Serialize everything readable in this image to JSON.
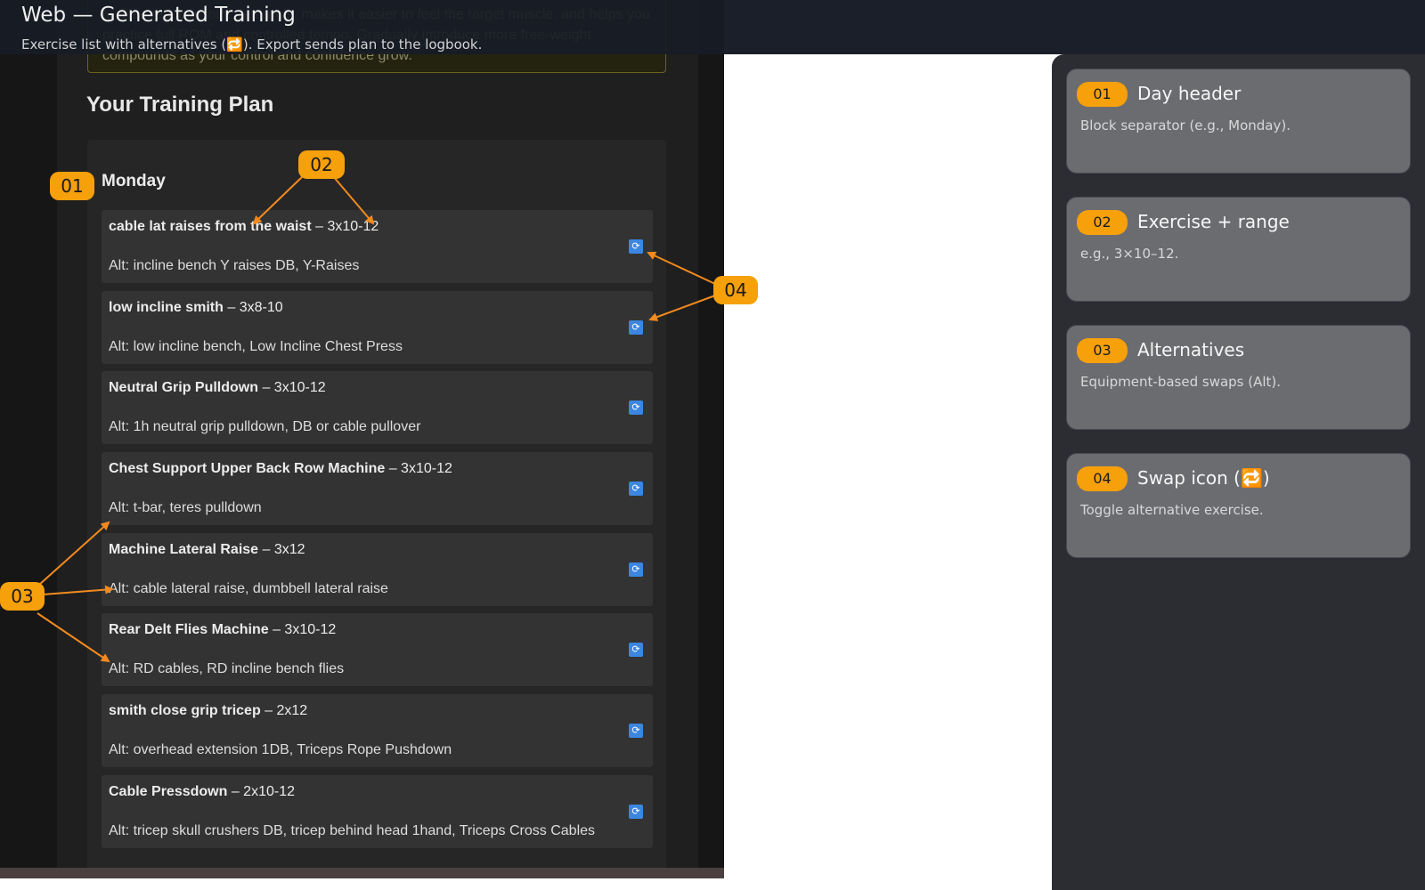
{
  "header": {
    "title": "Web — Generated Training",
    "subtitle": "Exercise list with alternatives (🔁). Export sends plan to the logbook."
  },
  "note_text": "ly. This reduces joint demands, makes it easier to feel the target muscle, and helps you practice full ROM and controlled tempo. Gradually introduce more free-weight compounds as your control and confidence grow.",
  "plan_title": "Your Training Plan",
  "day": "Monday",
  "exercises": [
    {
      "name": "cable lat raises from the waist",
      "range": " – 3x10-12",
      "alt": "Alt: incline bench Y raises DB, Y-Raises"
    },
    {
      "name": "low incline smith",
      "range": " – 3x8-10",
      "alt": "Alt: low incline bench, Low Incline Chest Press"
    },
    {
      "name": "Neutral Grip Pulldown",
      "range": " – 3x10-12",
      "alt": "Alt: 1h neutral grip pulldown, DB or cable pullover"
    },
    {
      "name": "Chest Support Upper Back Row Machine",
      "range": " – 3x10-12",
      "alt": "Alt: t-bar, teres pulldown"
    },
    {
      "name": "Machine Lateral Raise",
      "range": " – 3x12",
      "alt": "Alt: cable lateral raise, dumbbell lateral raise"
    },
    {
      "name": "Rear Delt Flies Machine",
      "range": " – 3x10-12",
      "alt": "Alt: RD cables, RD incline bench flies"
    },
    {
      "name": "smith close grip tricep",
      "range": " – 2x12",
      "alt": "Alt: overhead extension 1DB, Triceps Rope Pushdown"
    },
    {
      "name": "Cable Pressdown",
      "range": " – 2x10-12",
      "alt": "Alt: tricep skull crushers DB, tricep behind head 1hand, Triceps Cross Cables"
    }
  ],
  "callouts": {
    "c01": "01",
    "c02": "02",
    "c03": "03",
    "c04": "04"
  },
  "legend": [
    {
      "num": "01",
      "title": "Day header",
      "desc": "Block separator (e.g., Monday)."
    },
    {
      "num": "02",
      "title": "Exercise + range",
      "desc": "e.g., 3×10–12."
    },
    {
      "num": "03",
      "title": "Alternatives",
      "desc": "Equipment-based swaps (Alt)."
    },
    {
      "num": "04",
      "title": "Swap icon (🔁)",
      "desc": "Toggle alternative exercise."
    }
  ],
  "colors": {
    "accent": "#f6a00c",
    "swap_icon": "#3b86e0",
    "arrow": "#f28a1e"
  },
  "icons": {
    "swap": "swap-icon"
  }
}
